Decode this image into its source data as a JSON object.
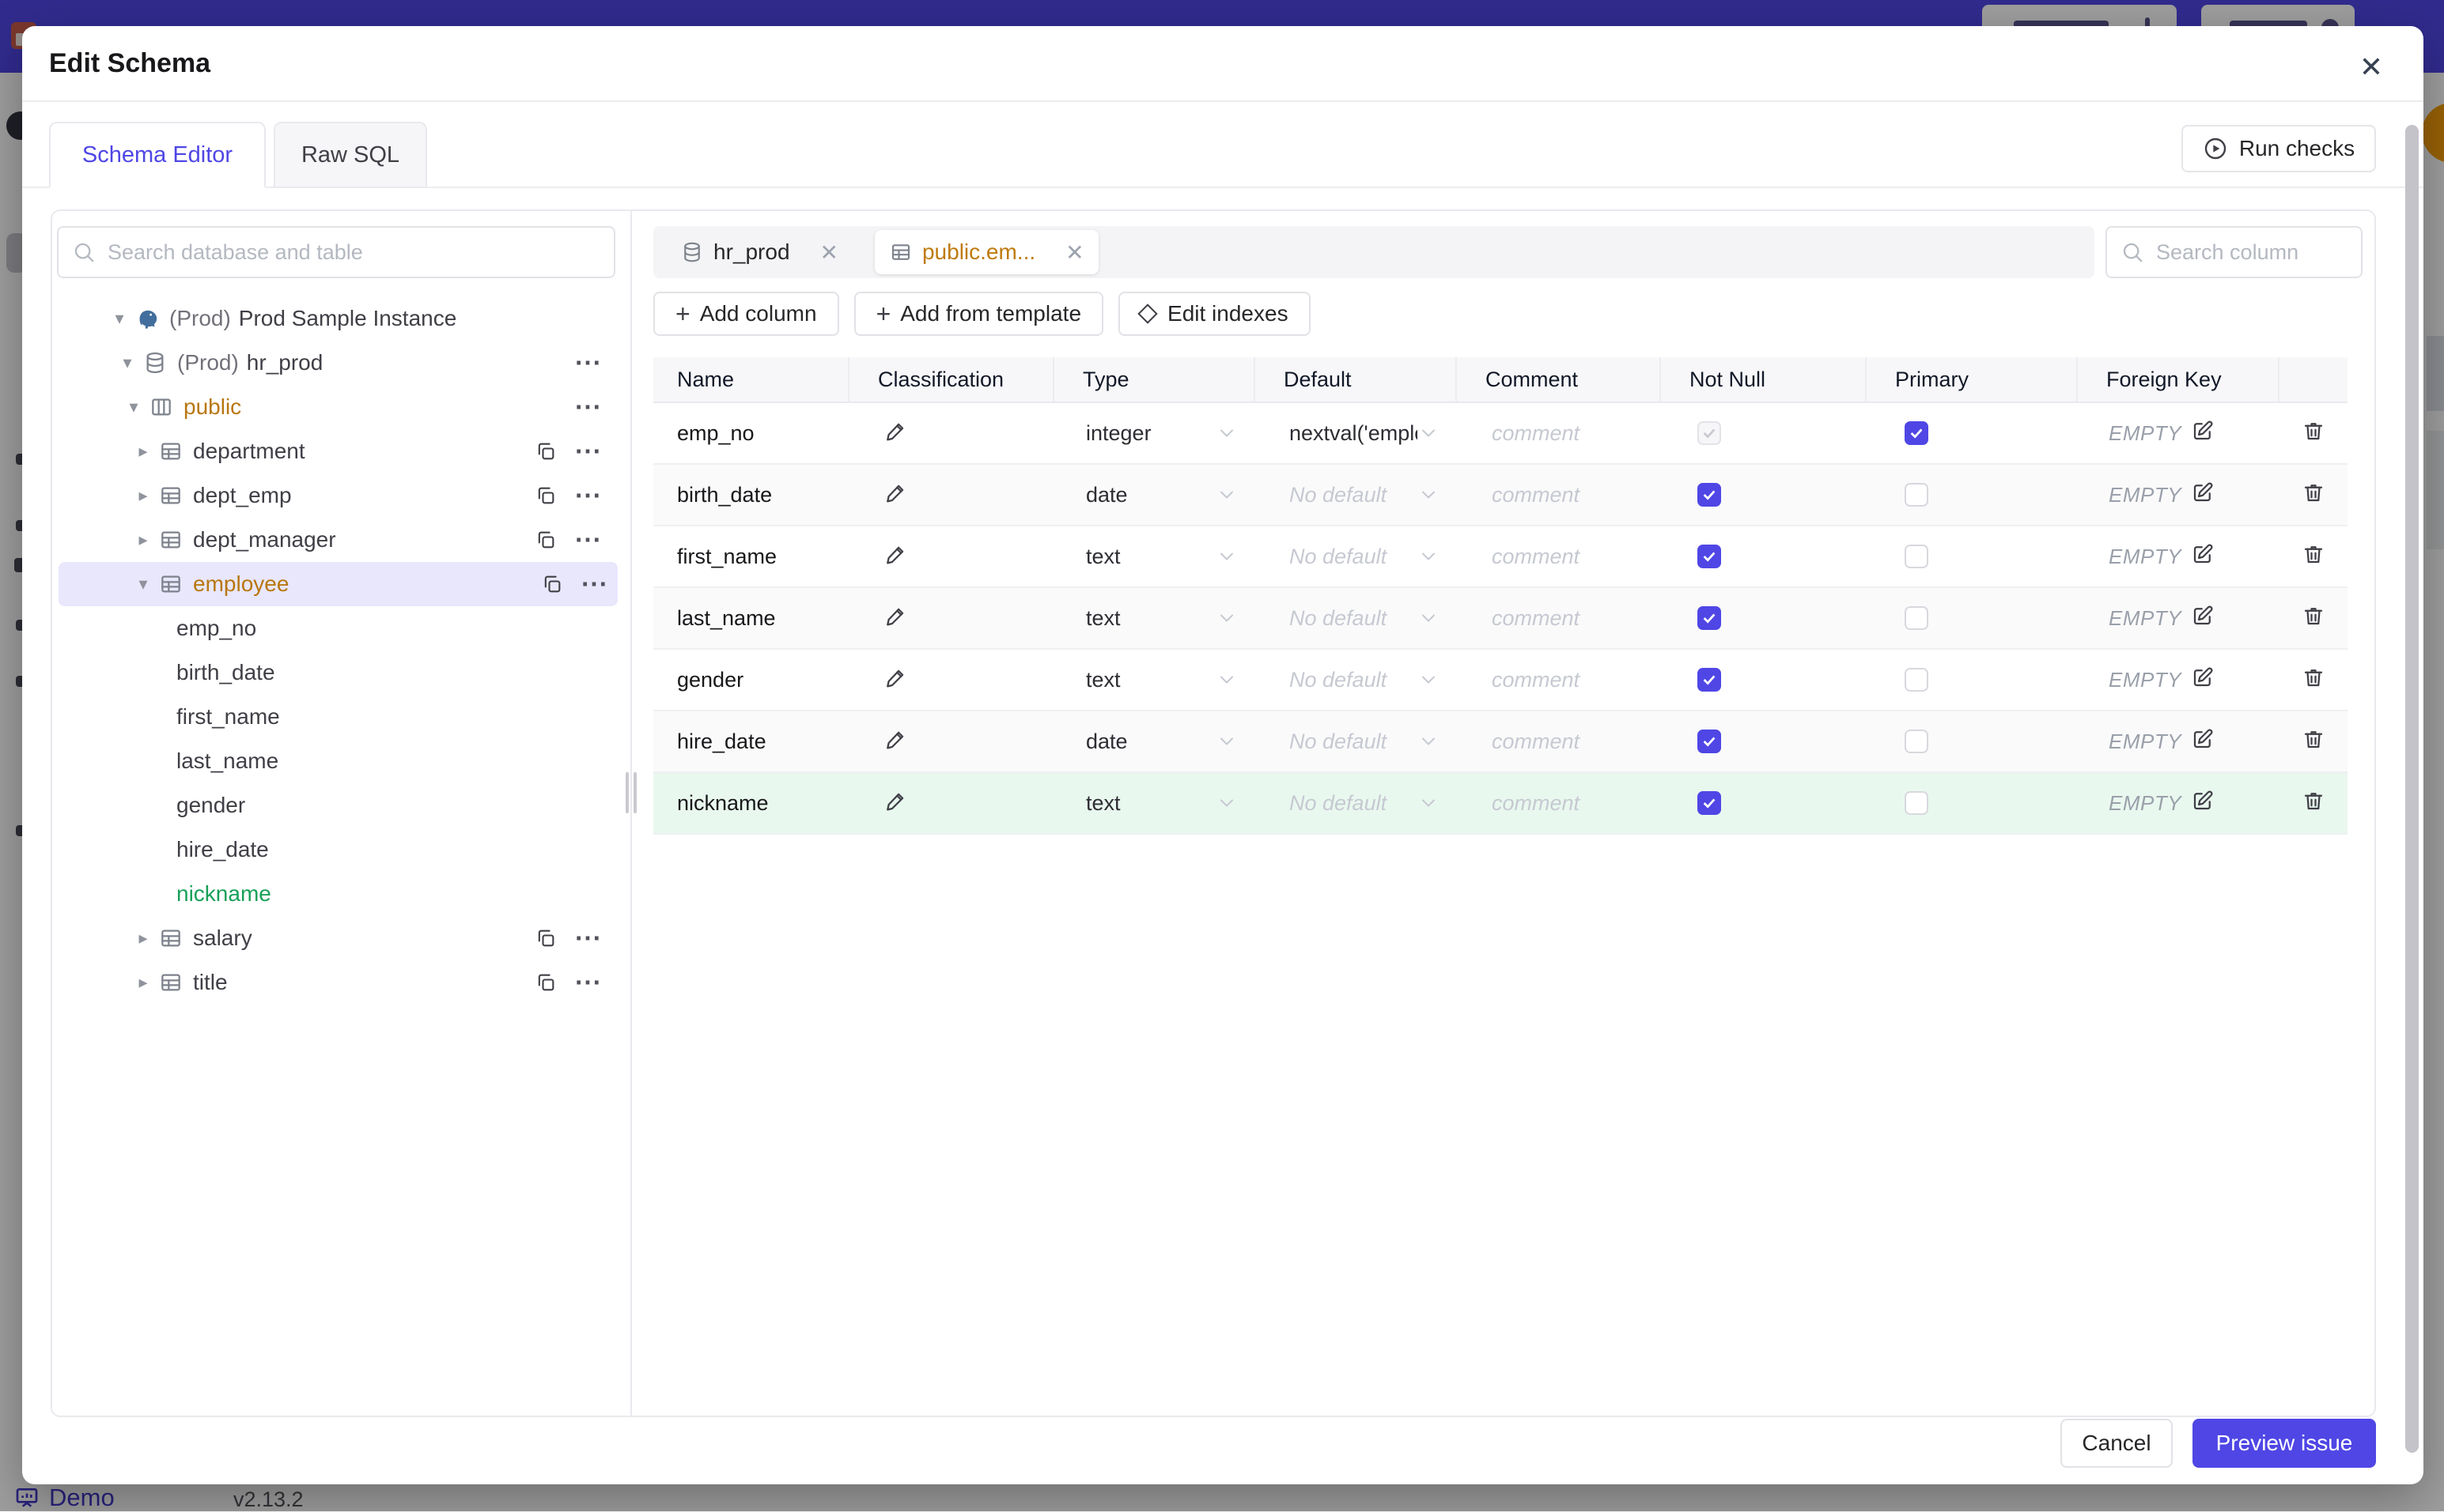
{
  "modal": {
    "title": "Edit Schema",
    "tabs": [
      {
        "label": "Schema Editor",
        "active": true
      },
      {
        "label": "Raw SQL",
        "active": false
      }
    ],
    "run_checks_label": "Run checks",
    "footer": {
      "cancel_label": "Cancel",
      "preview_label": "Preview issue"
    }
  },
  "sidebar": {
    "search_placeholder": "Search database and table",
    "tree": [
      {
        "level": 0,
        "icon": "postgres-icon",
        "caret": "down",
        "prefix": "(Prod)",
        "label": "Prod Sample Instance"
      },
      {
        "level": 1,
        "icon": "database-icon",
        "caret": "down",
        "prefix": "(Prod)",
        "label": "hr_prod"
      },
      {
        "level": 2,
        "icon": "schema-icon",
        "caret": "down",
        "label": "public",
        "modified": true
      },
      {
        "level": 3,
        "icon": "table-icon",
        "caret": "right",
        "label": "department"
      },
      {
        "level": 3,
        "icon": "table-icon",
        "caret": "right",
        "label": "dept_emp"
      },
      {
        "level": 3,
        "icon": "table-icon",
        "caret": "right",
        "label": "dept_manager"
      },
      {
        "level": 3,
        "icon": "table-icon",
        "caret": "down",
        "label": "employee",
        "modified": true,
        "selected": true
      },
      {
        "level": "column",
        "label": "emp_no"
      },
      {
        "level": "column",
        "label": "birth_date"
      },
      {
        "level": "column",
        "label": "first_name"
      },
      {
        "level": "column",
        "label": "last_name"
      },
      {
        "level": "column",
        "label": "gender"
      },
      {
        "level": "column",
        "label": "hire_date"
      },
      {
        "level": "column",
        "label": "nickname",
        "added": true
      },
      {
        "level": 3,
        "icon": "table-icon",
        "caret": "right",
        "label": "salary"
      },
      {
        "level": 3,
        "icon": "table-icon",
        "caret": "right",
        "label": "title"
      }
    ]
  },
  "editor": {
    "chips": [
      {
        "icon": "database-icon",
        "label": "hr_prod",
        "active": false
      },
      {
        "icon": "table-icon",
        "label": "public.em...",
        "active": true
      }
    ],
    "column_search_placeholder": "Search column",
    "toolbar": {
      "add_column_label": "Add column",
      "add_template_label": "Add from template",
      "edit_indexes_label": "Edit indexes"
    },
    "table": {
      "headers": [
        "Name",
        "Classification",
        "Type",
        "Default",
        "Comment",
        "Not Null",
        "Primary",
        "Foreign Key",
        ""
      ],
      "comment_placeholder": "comment",
      "default_placeholder": "No default",
      "foreign_key_empty": "EMPTY",
      "rows": [
        {
          "name": "emp_no",
          "type": "integer",
          "default_value": "nextval('employ",
          "not_null": true,
          "not_null_disabled": true,
          "primary": true,
          "foreign_key": "EMPTY"
        },
        {
          "name": "birth_date",
          "type": "date",
          "default_value": "",
          "not_null": true,
          "primary": false,
          "foreign_key": "EMPTY"
        },
        {
          "name": "first_name",
          "type": "text",
          "default_value": "",
          "not_null": true,
          "primary": false,
          "foreign_key": "EMPTY"
        },
        {
          "name": "last_name",
          "type": "text",
          "default_value": "",
          "not_null": true,
          "primary": false,
          "foreign_key": "EMPTY"
        },
        {
          "name": "gender",
          "type": "text",
          "default_value": "",
          "not_null": true,
          "primary": false,
          "foreign_key": "EMPTY"
        },
        {
          "name": "hire_date",
          "type": "date",
          "default_value": "",
          "not_null": true,
          "primary": false,
          "foreign_key": "EMPTY"
        },
        {
          "name": "nickname",
          "type": "text",
          "default_value": "",
          "not_null": true,
          "primary": false,
          "foreign_key": "EMPTY",
          "added": true
        }
      ]
    }
  },
  "background": {
    "demo_label": "Demo",
    "version": "v2.13.2"
  },
  "colors": {
    "accent": "#4f46e5",
    "modified_amber": "#b8770f",
    "added_green": "#18a058",
    "added_row_bg": "#e9f8ef",
    "selected_row_bg": "#e9e7fc",
    "header_bar": "#4f46e5"
  }
}
